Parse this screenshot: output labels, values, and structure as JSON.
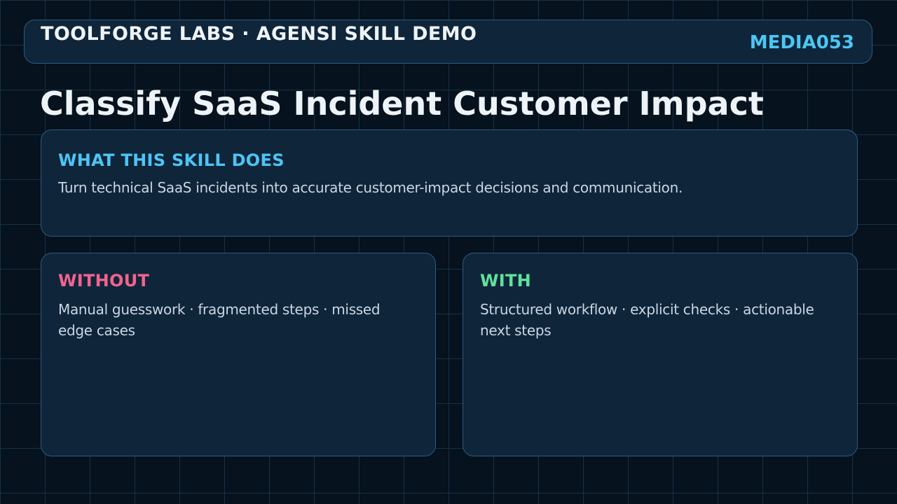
{
  "header": {
    "brand": "TOOLFORGE LABS · AGENSI SKILL DEMO",
    "code": "MEDIA053"
  },
  "title": "Classify SaaS Incident Customer Impact",
  "description": {
    "heading": "WHAT THIS SKILL DOES",
    "body": "Turn technical SaaS incidents into accurate customer-impact decisions and communication."
  },
  "without": {
    "heading": "WITHOUT",
    "body": "Manual guesswork · fragmented steps · missed edge cases"
  },
  "with": {
    "heading": "WITH",
    "body": "Structured workflow · explicit checks · actionable next steps"
  },
  "colors": {
    "accent": "#4cc5f4",
    "without": "#f2638f",
    "with": "#5fe29b",
    "background": "#06121d",
    "panel": "#0f253a",
    "border": "#2a5c82"
  }
}
